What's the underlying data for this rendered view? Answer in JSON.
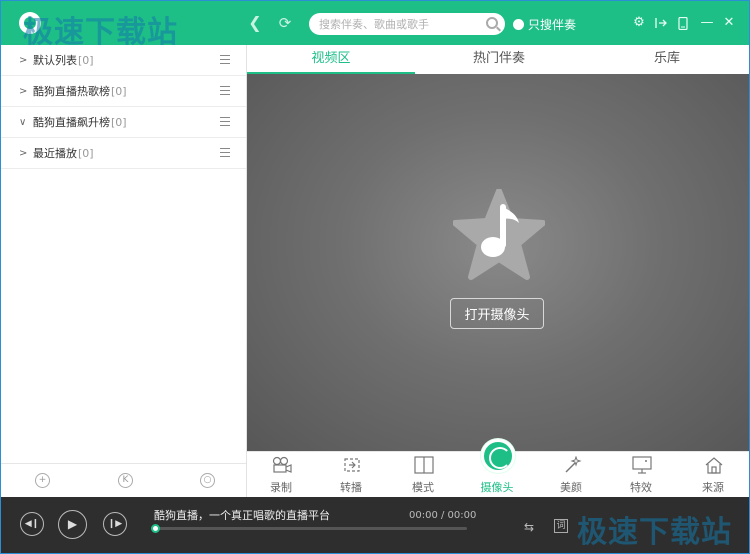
{
  "watermark": {
    "text": "极速下载站"
  },
  "header": {
    "search_placeholder": "搜索伴奏、歌曲或歌手",
    "only_accompaniment_label": "只搜伴奏"
  },
  "sidebar": {
    "items": [
      {
        "label": "默认列表",
        "count": "[0]",
        "expanded": false
      },
      {
        "label": "酷狗直播热歌榜",
        "count": "[0]",
        "expanded": false
      },
      {
        "label": "酷狗直播飙升榜",
        "count": "[0]",
        "expanded": true
      },
      {
        "label": "最近播放",
        "count": "[0]",
        "expanded": false
      }
    ],
    "footer_icons": [
      "add-icon",
      "k-icon",
      "search-icon"
    ]
  },
  "tabs": [
    {
      "label": "视频区",
      "active": true
    },
    {
      "label": "热门伴奏",
      "active": false
    },
    {
      "label": "乐库",
      "active": false
    }
  ],
  "video": {
    "open_camera_label": "打开摄像头"
  },
  "toolbar": {
    "items": [
      {
        "label": "录制",
        "icon": "video-camera-icon"
      },
      {
        "label": "转播",
        "icon": "relay-icon"
      },
      {
        "label": "模式",
        "icon": "layout-mode-icon"
      },
      {
        "label": "摄像头",
        "icon": "camera-circle-icon",
        "active": true
      },
      {
        "label": "美颜",
        "icon": "magic-wand-icon"
      },
      {
        "label": "特效",
        "icon": "monitor-icon"
      },
      {
        "label": "来源",
        "icon": "home-icon"
      }
    ]
  },
  "player": {
    "song_title": "酷狗直播，一个真正唱歌的直播平台",
    "time": "00:00 / 00:00",
    "progress": 0
  },
  "colors": {
    "accent": "#1dbf87",
    "player_bg": "#2e2e2e"
  }
}
